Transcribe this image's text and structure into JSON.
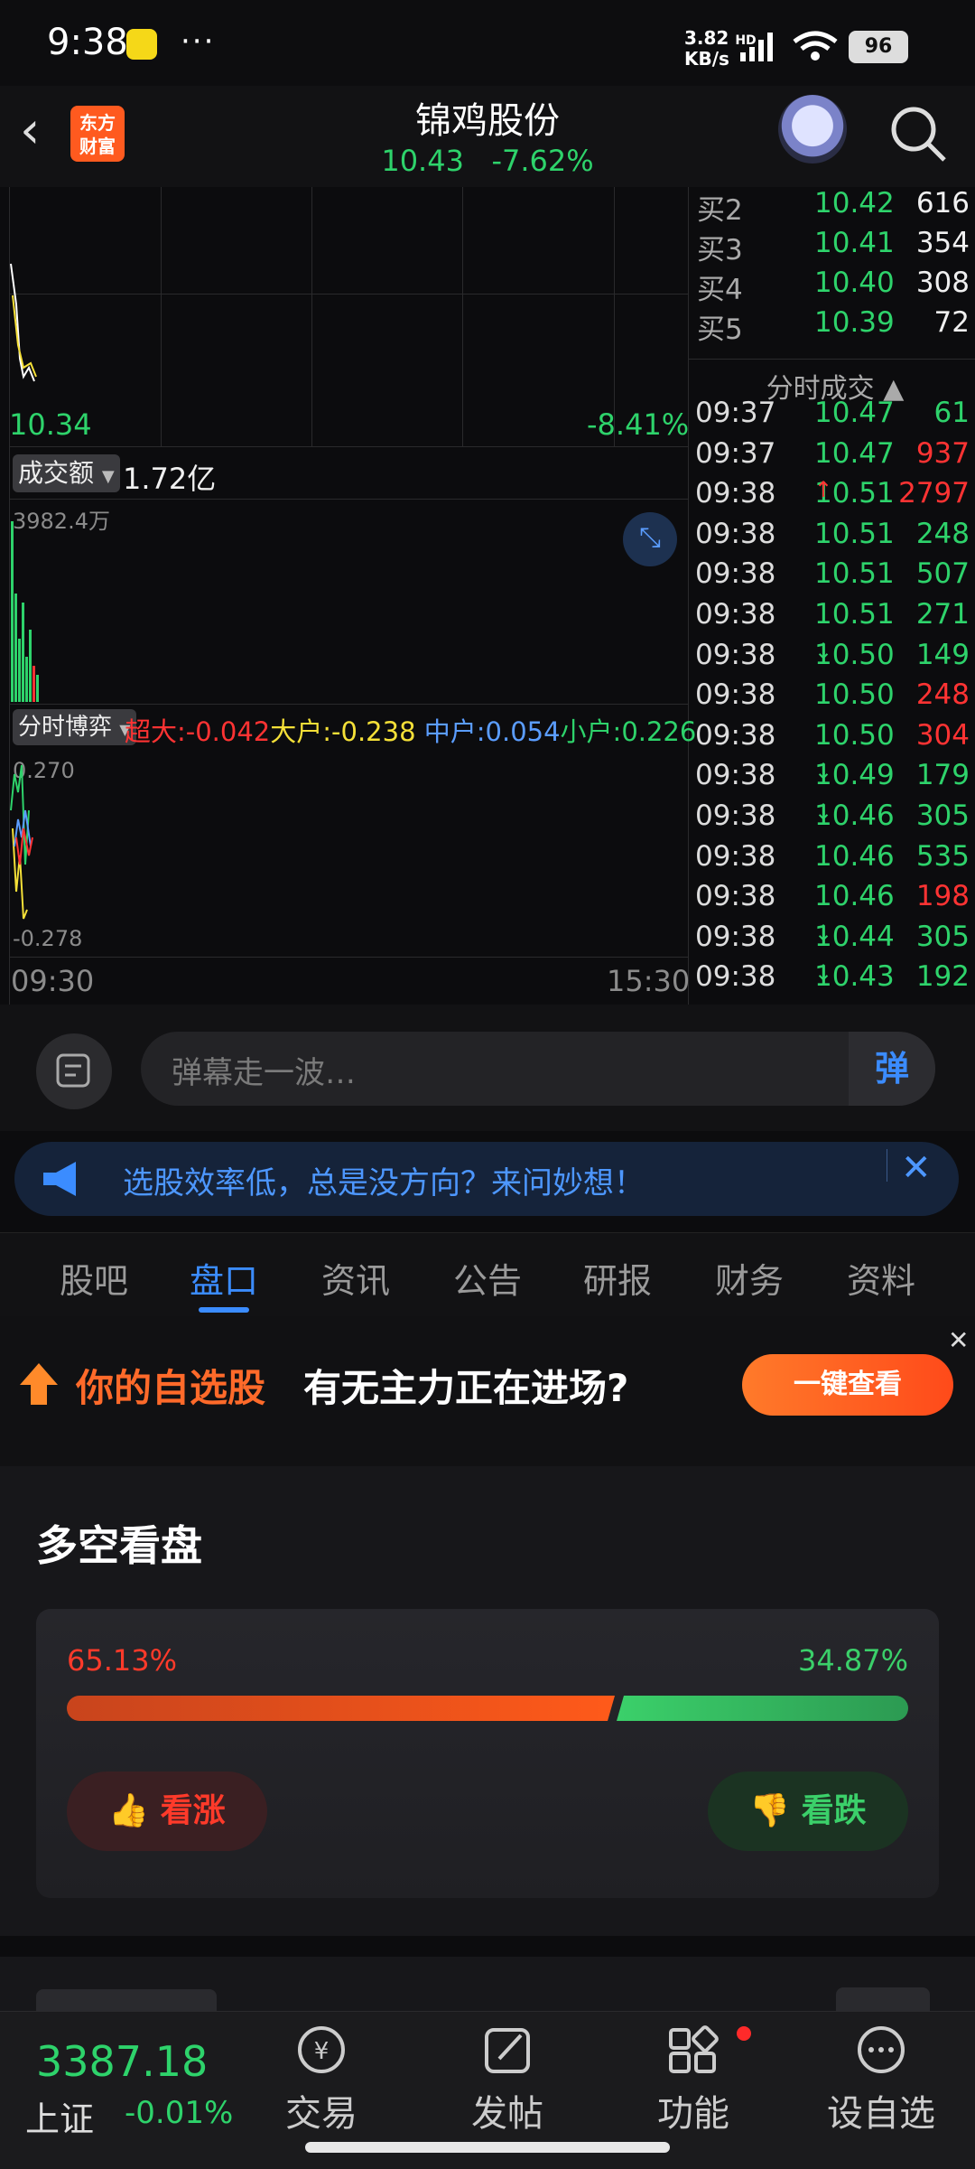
{
  "status_bar": {
    "time": "9:38",
    "dots": "···",
    "net_speed": "3.82",
    "net_unit": "KB/s",
    "hd": "HD",
    "battery": "96"
  },
  "header": {
    "back": "‹",
    "logo_line1": "东方",
    "logo_line2": "财富",
    "stock_name": "锦鸡股份",
    "price": "10.43",
    "change": "-7.62%"
  },
  "chart": {
    "price_low": "10.34",
    "pct_low": "-8.41%",
    "turnover_label": "成交额",
    "turnover_value": "1.72亿",
    "volume_max": "3982.4万",
    "flow_label": "分时博弈",
    "flow_super": "超大:-0.042",
    "flow_large": "大户:-0.238",
    "flow_mid": "中户:0.054",
    "flow_small": "小户:0.226",
    "flow_max": "0.270",
    "flow_min": "-0.278",
    "time_start": "09:30",
    "time_end": "15:30"
  },
  "order_book": {
    "bids": [
      {
        "label": "买2",
        "price": "10.42",
        "vol": "616"
      },
      {
        "label": "买3",
        "price": "10.41",
        "vol": "354"
      },
      {
        "label": "买4",
        "price": "10.40",
        "vol": "308"
      },
      {
        "label": "买5",
        "price": "10.39",
        "vol": "72"
      }
    ],
    "trades_title": "分时成交 ▲",
    "trades": [
      {
        "time": "09:37",
        "price": "10.47",
        "arrow": "",
        "vol": "61",
        "color": "green"
      },
      {
        "time": "09:37",
        "price": "10.47",
        "arrow": "",
        "vol": "937",
        "color": "red"
      },
      {
        "time": "09:38",
        "price": "10.51",
        "arrow": "↑",
        "vol": "2797",
        "color": "red"
      },
      {
        "time": "09:38",
        "price": "10.51",
        "arrow": "",
        "vol": "248",
        "color": "green"
      },
      {
        "time": "09:38",
        "price": "10.51",
        "arrow": "",
        "vol": "507",
        "color": "green"
      },
      {
        "time": "09:38",
        "price": "10.51",
        "arrow": "",
        "vol": "271",
        "color": "green"
      },
      {
        "time": "09:38",
        "price": "10.50",
        "arrow": "↓",
        "vol": "149",
        "color": "green"
      },
      {
        "time": "09:38",
        "price": "10.50",
        "arrow": "",
        "vol": "248",
        "color": "red"
      },
      {
        "time": "09:38",
        "price": "10.50",
        "arrow": "",
        "vol": "304",
        "color": "red"
      },
      {
        "time": "09:38",
        "price": "10.49",
        "arrow": "↓",
        "vol": "179",
        "color": "green"
      },
      {
        "time": "09:38",
        "price": "10.46",
        "arrow": "↓",
        "vol": "305",
        "color": "green"
      },
      {
        "time": "09:38",
        "price": "10.46",
        "arrow": "",
        "vol": "535",
        "color": "green"
      },
      {
        "time": "09:38",
        "price": "10.46",
        "arrow": "",
        "vol": "198",
        "color": "red"
      },
      {
        "time": "09:38",
        "price": "10.44",
        "arrow": "↓",
        "vol": "305",
        "color": "green"
      },
      {
        "time": "09:38",
        "price": "10.43",
        "arrow": "↓",
        "vol": "192",
        "color": "green"
      }
    ]
  },
  "danmu": {
    "placeholder": "弹幕走一波…",
    "send": "弹"
  },
  "notice": {
    "text": "选股效率低，总是没方向？来问妙想！"
  },
  "tabs": [
    "股吧",
    "盘口",
    "资讯",
    "公告",
    "研报",
    "财务",
    "资料"
  ],
  "promo": {
    "highlight": "你的自选股",
    "text": "有无主力正在进场?",
    "button": "一键查看"
  },
  "sentiment": {
    "title": "多空看盘",
    "bull_pct": "65.13%",
    "bear_pct": "34.87%",
    "bull_fraction": 0.6513,
    "bull_button": "看涨",
    "bear_button": "看跌"
  },
  "bottom_bar": {
    "index_value": "3387.18",
    "index_name": "上证",
    "index_change": "-0.01%",
    "items": [
      "交易",
      "发帖",
      "功能",
      "设自选"
    ]
  }
}
